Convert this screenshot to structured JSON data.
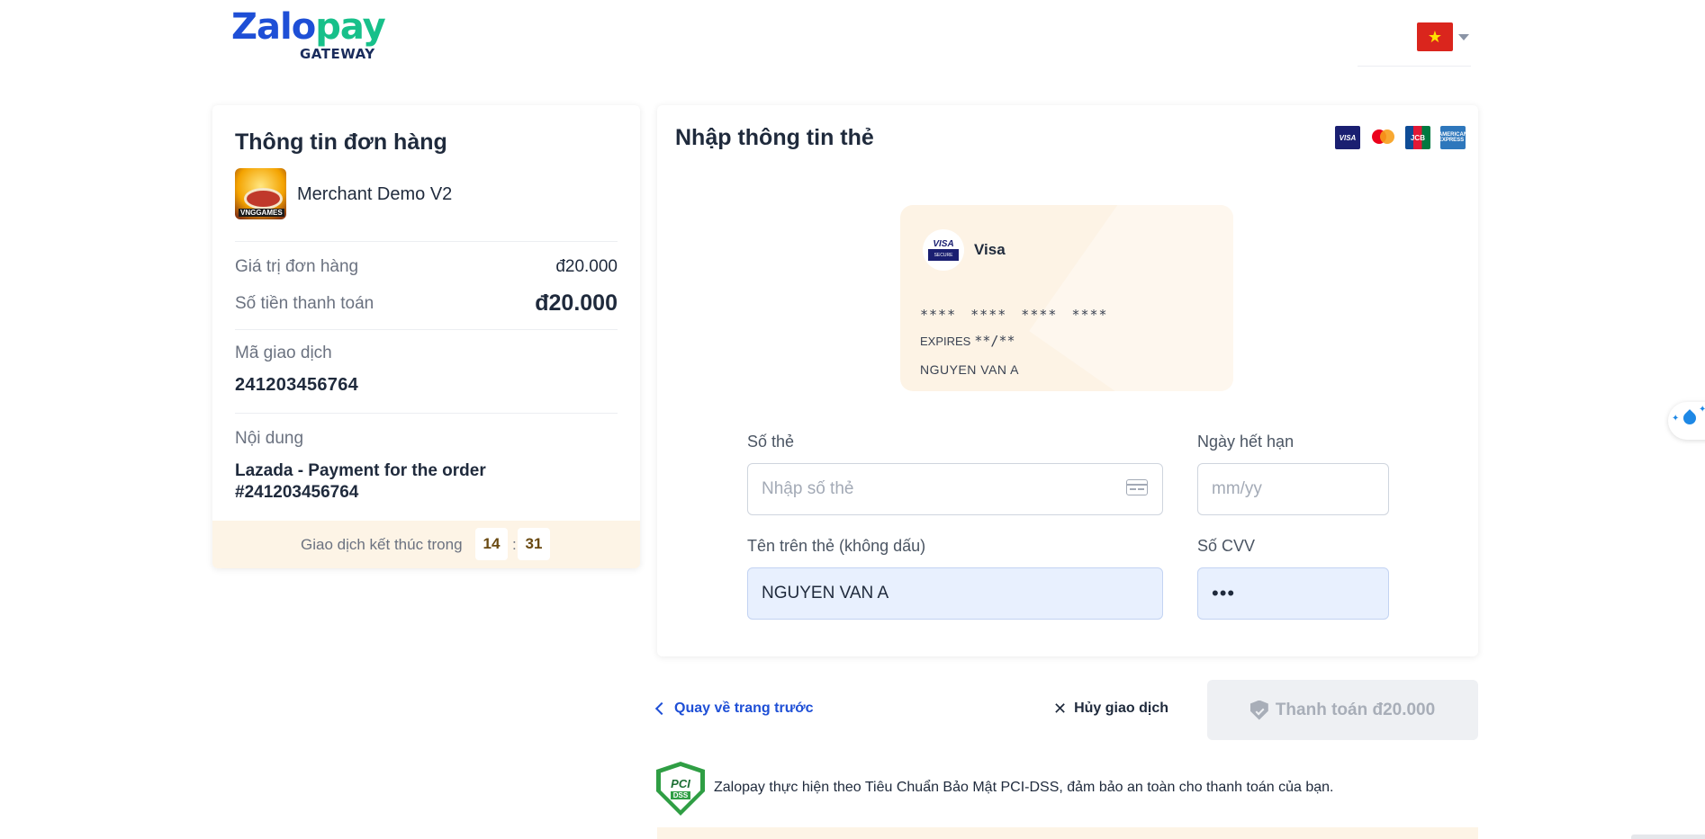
{
  "header": {
    "logo": {
      "word_part1": "Zalo",
      "word_part2": "pay",
      "subtitle": "GATEWAY"
    },
    "language": {
      "flag": "vietnam-flag",
      "flag_glyph": "★"
    }
  },
  "order": {
    "title": "Thông tin đơn hàng",
    "merchant_name": "Merchant Demo V2",
    "merchant_logo_text": "VNGGAMES",
    "order_value_label": "Giá trị đơn hàng",
    "order_value": "đ20.000",
    "payment_amount_label": "Số tiền thanh toán",
    "payment_amount": "đ20.000",
    "transaction_label": "Mã giao dịch",
    "transaction_id": "241203456764",
    "content_label": "Nội dung",
    "content_value": "Lazada - Payment for the order #241203456764",
    "timer_label": "Giao dịch kết thúc trong",
    "timer_minutes": "14",
    "timer_separator": ":",
    "timer_seconds": "31"
  },
  "card_form": {
    "title": "Nhập thông tin thẻ",
    "accepted_brands": [
      "visa-logo",
      "mastercard-logo",
      "jcb-logo",
      "amex-logo"
    ],
    "brand_text": {
      "visa": "VISA",
      "visa_secure": "SECURE",
      "jcb": "JCB",
      "amex": "AMERICAN EXPRESS"
    },
    "preview": {
      "brand_name": "Visa",
      "brand_logo_text": "VISA",
      "brand_logo_sub": "SECURE",
      "number_mask": "**** **** **** ****",
      "expires_label": "EXPIRES",
      "expires_mask": "**/**",
      "holder": "NGUYEN VAN A"
    },
    "card_number": {
      "label": "Số thẻ",
      "placeholder": "Nhập số thẻ",
      "value": ""
    },
    "expiry": {
      "label": "Ngày hết hạn",
      "placeholder": "mm/yy",
      "value": ""
    },
    "holder_name": {
      "label": "Tên trên thẻ (không dấu)",
      "value": "NGUYEN VAN A"
    },
    "cvv": {
      "label": "Số CVV",
      "value": "•••"
    }
  },
  "actions": {
    "back_label": "Quay về trang trước",
    "cancel_label": "Hủy giao dịch",
    "pay_label": "Thanh toán đ20.000"
  },
  "security": {
    "badge_text_main": "PCI",
    "badge_text_sub": "DSS",
    "notice": "Zalopay thực hiện theo Tiêu Chuẩn Bảo Mật PCI-DSS, đảm bảo an toàn cho thanh toán của bạn."
  },
  "colors": {
    "brand_blue": "#1e4fd6",
    "brand_green": "#17c08a",
    "timer_bg": "#fdf4e6",
    "preview_bg": "#fdf3e5",
    "filled_field_bg": "#e8f0fe",
    "disabled_button_bg": "#eef0f3",
    "pci_green": "#2f9e44"
  }
}
